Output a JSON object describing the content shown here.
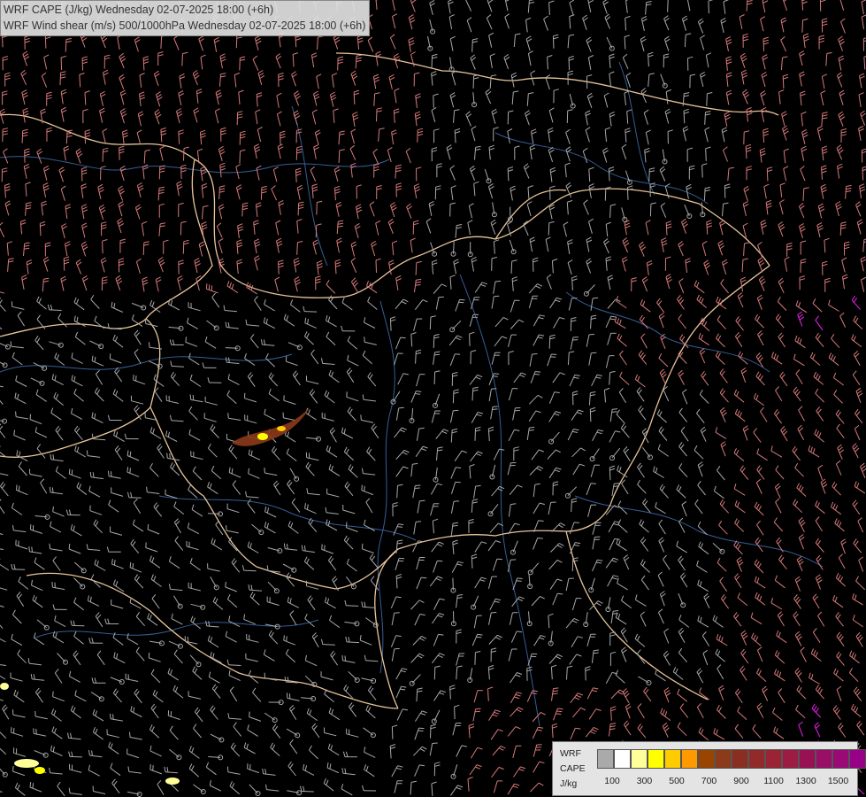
{
  "header": {
    "title_1": "WRF CAPE (J/kg) Wednesday 02-07-2025 18:00 (+6h)",
    "title_2": "WRF Wind shear (m/s) 500/1000hPa Wednesday 02-07-2025 18:00 (+6h)"
  },
  "legend": {
    "model": "WRF",
    "variable": "CAPE",
    "unit": "J/kg",
    "ticks": [
      "100",
      "300",
      "500",
      "700",
      "900",
      "1100",
      "1300",
      "1500"
    ],
    "colors": [
      "#aaaaaa",
      "#ffffff",
      "#ffff99",
      "#ffff00",
      "#ffcc00",
      "#ff9900",
      "#994400",
      "#8b3a1a",
      "#8b2e22",
      "#922a2a",
      "#9a2433",
      "#9c1c44",
      "#991155",
      "#990e66",
      "#990a77",
      "#990088"
    ]
  },
  "colors": {
    "background": "#000000",
    "borders": "#e8c49a",
    "rivers": "#3f6fb0",
    "barb_gray": "#a8a8a8",
    "barb_pink": "#d67a7a",
    "barb_magenta": "#ee22ee"
  }
}
